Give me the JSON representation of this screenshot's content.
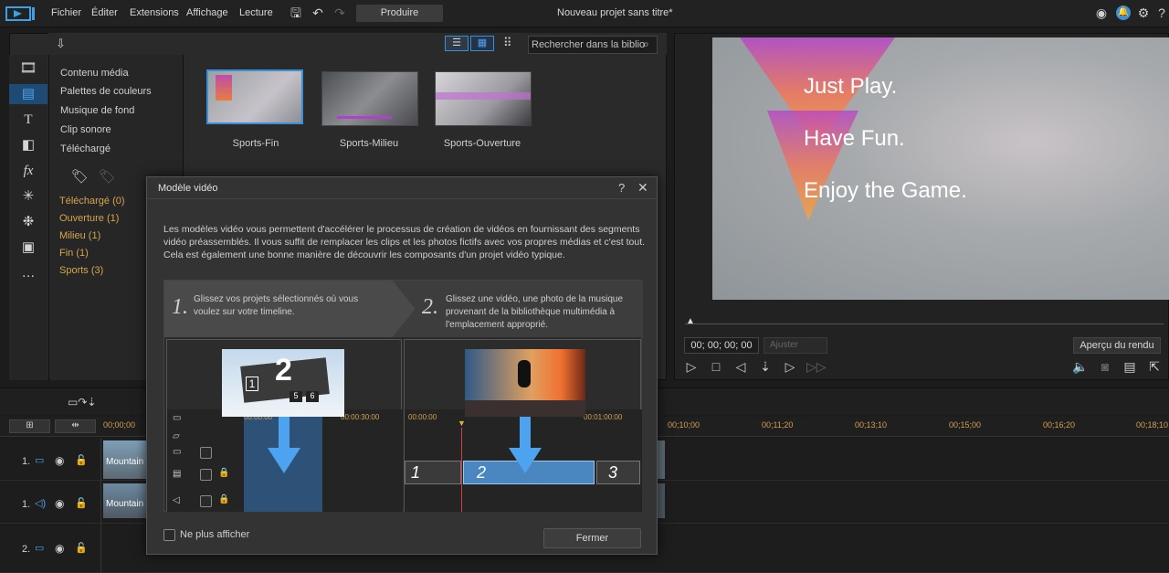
{
  "menubar": {
    "items": [
      "Fichier",
      "Éditer",
      "Extensions",
      "Affichage",
      "Lecture"
    ],
    "produce_label": "Produire",
    "project_title": "Nouveau projet sans titre*"
  },
  "library": {
    "nav_items": [
      "Contenu média",
      "Palettes de couleurs",
      "Musique de fond",
      "Clip sonore",
      "Téléchargé"
    ],
    "tags": [
      "Téléchargé  (0)",
      "Ouverture  (1)",
      "Milieu  (1)",
      "Fin  (1)",
      "Sports  (3)"
    ],
    "search_placeholder": "Rechercher dans la biblio",
    "thumbnails": [
      "Sports-Fin",
      "Sports-Milieu",
      "Sports-Ouverture"
    ]
  },
  "preview": {
    "lines": [
      "Just Play.",
      "Have Fun.",
      "Enjoy the Game."
    ],
    "timecode": "00; 00; 00; 00",
    "fit_label": "Ajuster",
    "render_preview": "Aperçu du rendu"
  },
  "timeline": {
    "times": [
      "00;00;00",
      "00;10;00",
      "00;11;20",
      "00;13;10",
      "00;15;00",
      "00;16;20",
      "00;18;10"
    ],
    "track_labels": [
      "1.",
      "1.",
      "2."
    ],
    "clip_name": "Mountain"
  },
  "modal": {
    "title": "Modèle vidéo",
    "description": "Les modèles vidéo vous permettent d'accélérer le processus de création de vidéos en fournissant des segments vidéo préassemblés. Il vous suffit de remplacer les clips et les photos fictifs avec vos propres médias et c'est tout. Cela est également une bonne manière de découvrir les composants d'un projet vidéo typique.",
    "step1_num": "1.",
    "step1_text": "Glissez vos projets sélectionnés où vous voulez sur votre timeline.",
    "step2_num": "2.",
    "step2_text": "Glissez une vidéo, une photo de la musique provenant de la bibliothèque multimédia à l'emplacement approprié.",
    "left_time_a": "00:00:00",
    "left_time_b": "00:00:30:00",
    "right_time_a": "00:00:00",
    "right_time_b": "00:01:00:00",
    "slot_1": "1",
    "slot_2": "2",
    "slot_3": "3",
    "big_2": "2",
    "small_1": "1",
    "small_5": "5",
    "small_6": "6",
    "dont_show": "Ne plus afficher",
    "close_label": "Fermer"
  }
}
